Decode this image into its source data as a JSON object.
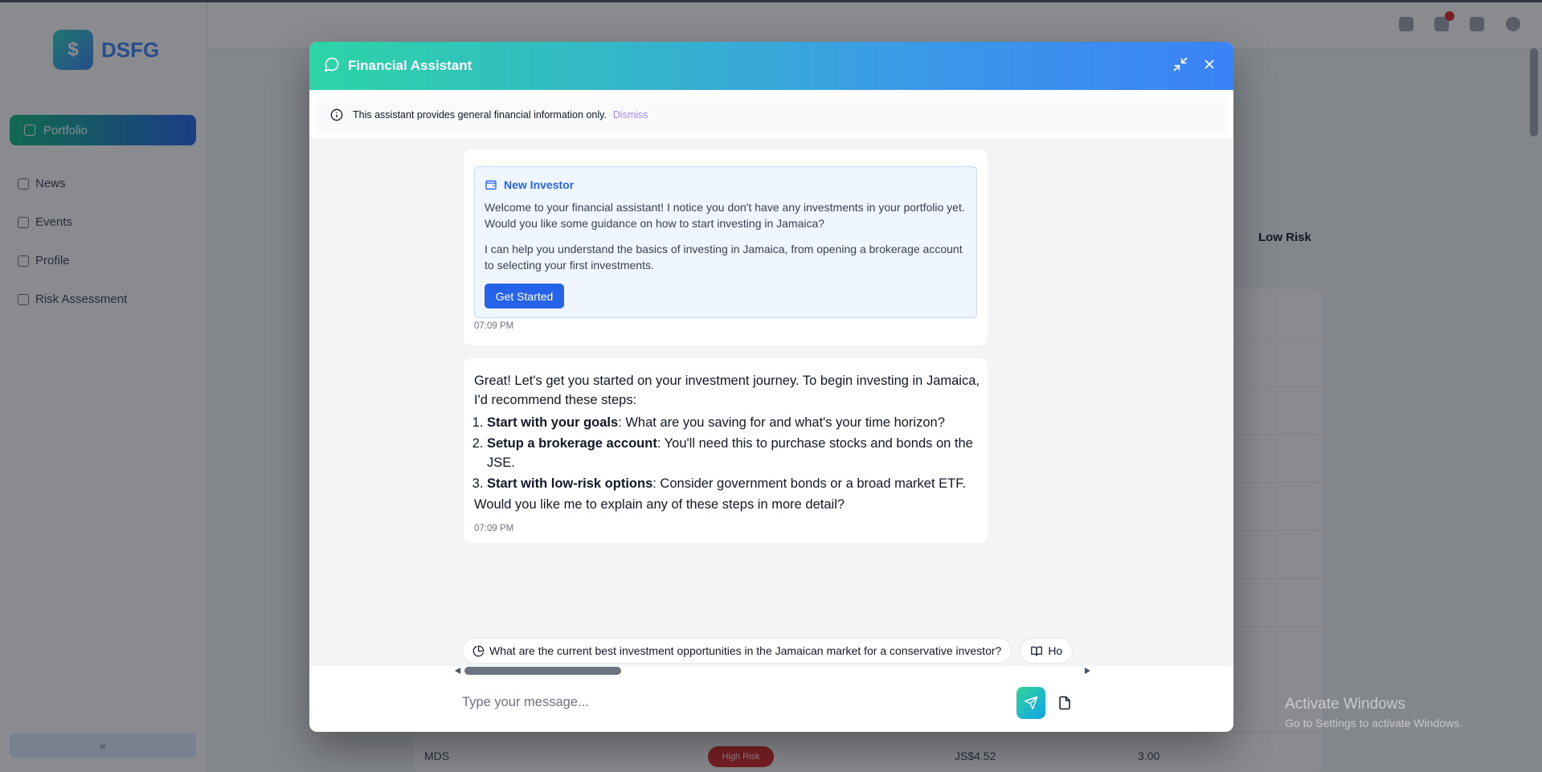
{
  "background": {
    "sidebar": {
      "logo_letter": "$",
      "logo_text": "DSFG",
      "active_item": "Portfolio",
      "items": [
        "News",
        "Events",
        "Profile",
        "Risk Assessment"
      ],
      "collapse_glyph": "«"
    },
    "table": {
      "risk_label": "Low Risk",
      "last_row": {
        "symbol": "MDS",
        "badge": "High Risk",
        "value1": "JS$4.52",
        "value2": "3.00"
      }
    },
    "activate_windows": {
      "title": "Activate Windows",
      "subtitle": "Go to Settings to activate Windows."
    }
  },
  "assistant": {
    "title": "Financial Assistant",
    "header_icon": "chat-bubble-icon",
    "minimize_icon": "minimize-arrows-icon",
    "close_icon": "close-icon",
    "notice": {
      "text": "This assistant provides general financial information only.",
      "dismiss_label": "Dismiss"
    },
    "messages": [
      {
        "card_title": "New Investor",
        "card_icon": "wallet-icon",
        "paragraphs": [
          "Welcome to your financial assistant! I notice you don't have any investments in your portfolio yet. Would you like some guidance on how to start investing in Jamaica?",
          "I can help you understand the basics of investing in Jamaica, from opening a brokerage account to selecting your first investments."
        ],
        "button_label": "Get Started",
        "time": "07:09 PM"
      },
      {
        "intro": "Great! Let's get you started on your investment journey. To begin investing in Jamaica, I'd recommend these steps:",
        "steps": [
          {
            "bold": "Start with your goals",
            "text": ": What are you saving for and what's your time horizon?"
          },
          {
            "bold": "Setup a brokerage account",
            "text": ": You'll need this to purchase stocks and bonds on the JSE."
          },
          {
            "bold": "Start with low-risk options",
            "text": ": Consider government bonds or a broad market ETF."
          }
        ],
        "outro": "Would you like me to explain any of these steps in more detail?",
        "time": "07:09 PM"
      }
    ],
    "suggestions": [
      {
        "icon": "pie-chart-icon",
        "label": "What are the current best investment opportunities in the Jamaican market for a conservative investor?"
      },
      {
        "icon": "book-open-icon",
        "label": "Ho"
      }
    ],
    "input": {
      "placeholder": "Type your message...",
      "value": ""
    },
    "send_icon": "send-icon",
    "attach_icon": "file-icon"
  }
}
